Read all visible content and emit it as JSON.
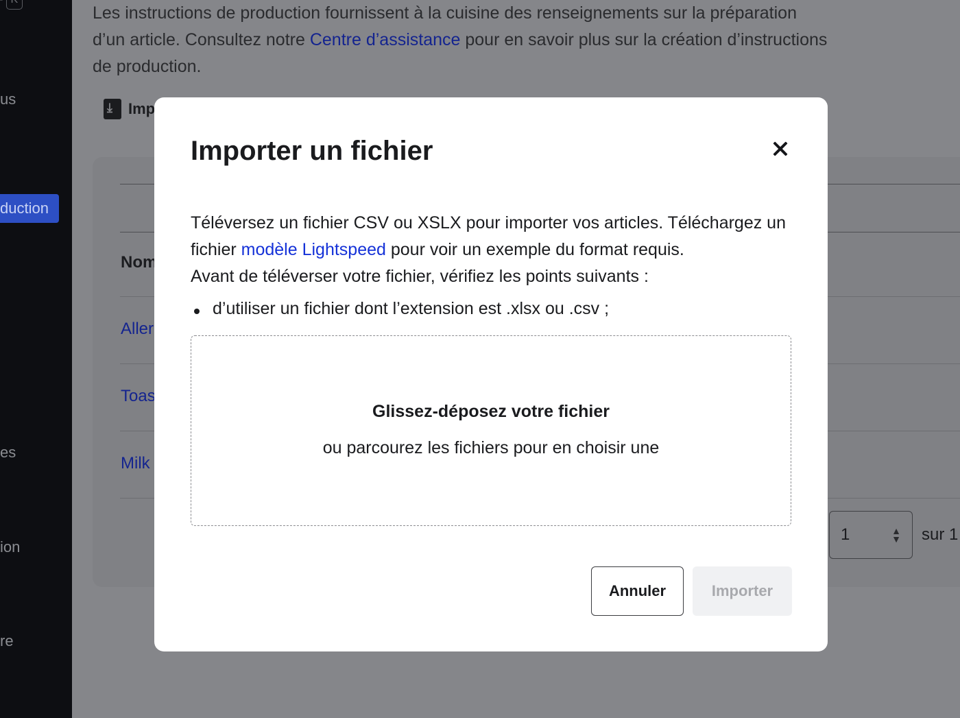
{
  "sidebar": {
    "shortcut_keys": [
      "+",
      "K"
    ],
    "items": [
      {
        "label": "us"
      },
      {
        "label": "duction",
        "active": true
      },
      {
        "label": "es"
      },
      {
        "label": "ion"
      },
      {
        "label": "re"
      }
    ]
  },
  "page": {
    "intro_before": "Les instructions de production fournissent à la cuisine des renseignements sur la préparation d’un article. Consultez notre ",
    "intro_link": "Centre d’assistance",
    "intro_after": " pour en savoir plus sur la création d’instructions de production.",
    "import_button": "Imp",
    "table": {
      "header": "Nom",
      "rows": [
        "Aller",
        "Toas",
        "Milk"
      ]
    },
    "pagination": {
      "page": "1",
      "of": "sur 1"
    }
  },
  "modal": {
    "title": "Importer un fichier",
    "desc_line1": "Téléversez un fichier CSV ou XSLX pour importer vos articles. Téléchargez un fichier ",
    "desc_link": "modèle Lightspeed",
    "desc_line2": " pour voir un exemple du format requis.",
    "desc_line3": "Avant de téléverser votre fichier, vérifiez les points suivants :",
    "bullets": [
      "d’utiliser un fichier dont l’extension est .xlsx ou .csv ;"
    ],
    "dropzone_title": "Glissez-déposez votre fichier",
    "dropzone_sub": "ou parcourez les fichiers pour en choisir une",
    "cancel_label": "Annuler",
    "import_label": "Importer"
  },
  "colors": {
    "overlay_bg": "#85868a",
    "sidebar_bg": "#0d0e12",
    "active_nav": "#2d4fc4",
    "link": "#1532d8",
    "disabled_btn_bg": "#f0f1f3"
  }
}
